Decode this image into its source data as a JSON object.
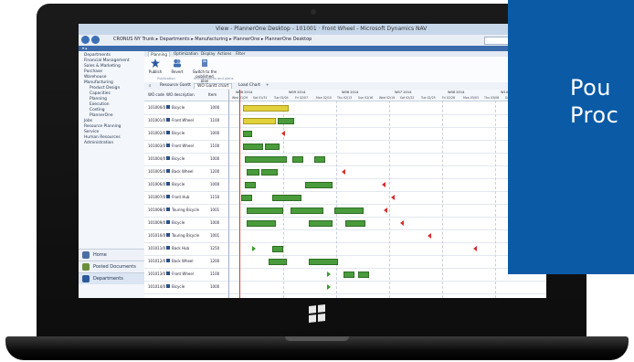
{
  "window": {
    "title": "View - PlannerOne Desktop - 101001 · Front Wheel - Microsoft Dynamics NAV",
    "breadcrumb": "CRONUS NY Trunk ▸ Departments ▸ Manufacturing ▸ PlannerOne ▸ PlannerOne Desktop",
    "navbar_label": "▾ ▴"
  },
  "ribbon": {
    "tabs": [
      "Planning",
      "Optimization",
      "Display",
      "Actions",
      "Filter"
    ],
    "active_tab": "Planning",
    "buttons": [
      {
        "label": "Publish",
        "icon": "star-icon"
      },
      {
        "label": "Revert",
        "icon": "people-icon"
      },
      {
        "label": "Switch to the published plan",
        "icon": "switch-icon"
      }
    ],
    "groups": [
      "Publication",
      "Environments and plans"
    ]
  },
  "sidebar": {
    "items": [
      {
        "label": "Departments",
        "level": 1
      },
      {
        "label": "Financial Management",
        "level": 1
      },
      {
        "label": "Sales & Marketing",
        "level": 1
      },
      {
        "label": "Purchase",
        "level": 1
      },
      {
        "label": "Warehouse",
        "level": 1
      },
      {
        "label": "Manufacturing",
        "level": 1
      },
      {
        "label": "Product Design",
        "level": 2
      },
      {
        "label": "Capacities",
        "level": 2
      },
      {
        "label": "Planning",
        "level": 2
      },
      {
        "label": "Execution",
        "level": 2
      },
      {
        "label": "Costing",
        "level": 2
      },
      {
        "label": "PlannerOne",
        "level": 2
      },
      {
        "label": "Jobs",
        "level": 1
      },
      {
        "label": "Resource Planning",
        "level": 1
      },
      {
        "label": "Service",
        "level": 1
      },
      {
        "label": "Human Resources",
        "level": 1
      },
      {
        "label": "Administration",
        "level": 1
      }
    ],
    "bottom": [
      "Home",
      "Posted Documents",
      "Departments"
    ]
  },
  "content": {
    "tabs": [
      "Resource Gantt",
      "WO Gantt chart",
      "Load Chart",
      "+"
    ],
    "active_tab": "WO Gantt chart",
    "columns": [
      "WO code",
      "WO description",
      "Item"
    ],
    "weeks": [
      "W08 2014",
      "W09 2014",
      "W06 2014",
      "W07 2014",
      "W08 2014",
      "W10 2014"
    ],
    "days": [
      "Wed 01/29",
      "Sat 01/31",
      "Tue 02/04",
      "Fri 02/07",
      "Mon 02/10",
      "Thu 02/13",
      "Sun 02/16",
      "Wed 02/19",
      "Sat 02/22",
      "Tue 02/25",
      "Fri 02/28",
      "Mon 03/03",
      "Thu 03/06",
      "Sun 03/09",
      "Wed 03/12"
    ],
    "rows": [
      {
        "code": "101000/0",
        "desc": "Bicycle",
        "item": "1000"
      },
      {
        "code": "101001/0",
        "desc": "Front Wheel",
        "item": "1100"
      },
      {
        "code": "101002/0",
        "desc": "Bicycle",
        "item": "1000"
      },
      {
        "code": "101003/0",
        "desc": "Front Wheel",
        "item": "1100"
      },
      {
        "code": "101004/0",
        "desc": "Bicycle",
        "item": "1000"
      },
      {
        "code": "101005/0",
        "desc": "Back Wheel",
        "item": "1200"
      },
      {
        "code": "101006/0",
        "desc": "Bicycle",
        "item": "1000"
      },
      {
        "code": "101007/0",
        "desc": "Front Hub",
        "item": "1150"
      },
      {
        "code": "101008/0",
        "desc": "Touring Bicycle",
        "item": "1001"
      },
      {
        "code": "101009/0",
        "desc": "Bicycle",
        "item": "1000"
      },
      {
        "code": "101010/0",
        "desc": "Touring Bicycle",
        "item": "1001"
      },
      {
        "code": "101011/0",
        "desc": "Back Hub",
        "item": "1250"
      },
      {
        "code": "101012/0",
        "desc": "Back Wheel",
        "item": "1200"
      },
      {
        "code": "101013/0",
        "desc": "Front Wheel",
        "item": "1100"
      },
      {
        "code": "101014/0",
        "desc": "Bicycle",
        "item": "1000"
      }
    ]
  },
  "promo": {
    "line1": "Pou",
    "line2": "Proc",
    "color": "#0a5aa6"
  }
}
